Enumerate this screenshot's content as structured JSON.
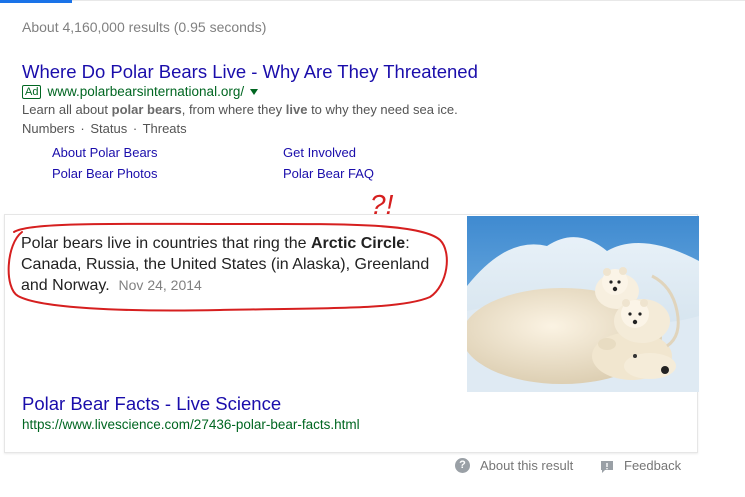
{
  "stats": "About 4,160,000 results (0.95 seconds)",
  "ad": {
    "title": "Where Do Polar Bears Live - Why Are They Threatened",
    "badge": "Ad",
    "url": "www.polarbearsinternational.org/",
    "desc_pre1": "Learn all about ",
    "desc_b1": "polar bears",
    "desc_mid": ", from where they ",
    "desc_b2": "live",
    "desc_post": " to why they need sea ice.",
    "extensions": [
      "Numbers",
      "Status",
      "Threats"
    ],
    "ext_separator": "·",
    "sitelinks": [
      "About Polar Bears",
      "Get Involved",
      "Polar Bear Photos",
      "Polar Bear FAQ"
    ]
  },
  "snippet": {
    "text1": "Polar bears live in countries that ring the ",
    "bold1": "Arctic Circle",
    "text2": ": Canada, Russia, the United States (in Alaska), Greenland and Norway.",
    "date": "Nov 24, 2014"
  },
  "result": {
    "title": "Polar Bear Facts - Live Science",
    "url": "https://www.livescience.com/27436-polar-bear-facts.html"
  },
  "footer": {
    "about": "About this result",
    "feedback": "Feedback"
  },
  "annotation": {
    "mark": "?!",
    "color": "#d61f1f"
  },
  "icons": [
    "caret-down-icon",
    "help-circle-icon",
    "feedback-icon"
  ]
}
